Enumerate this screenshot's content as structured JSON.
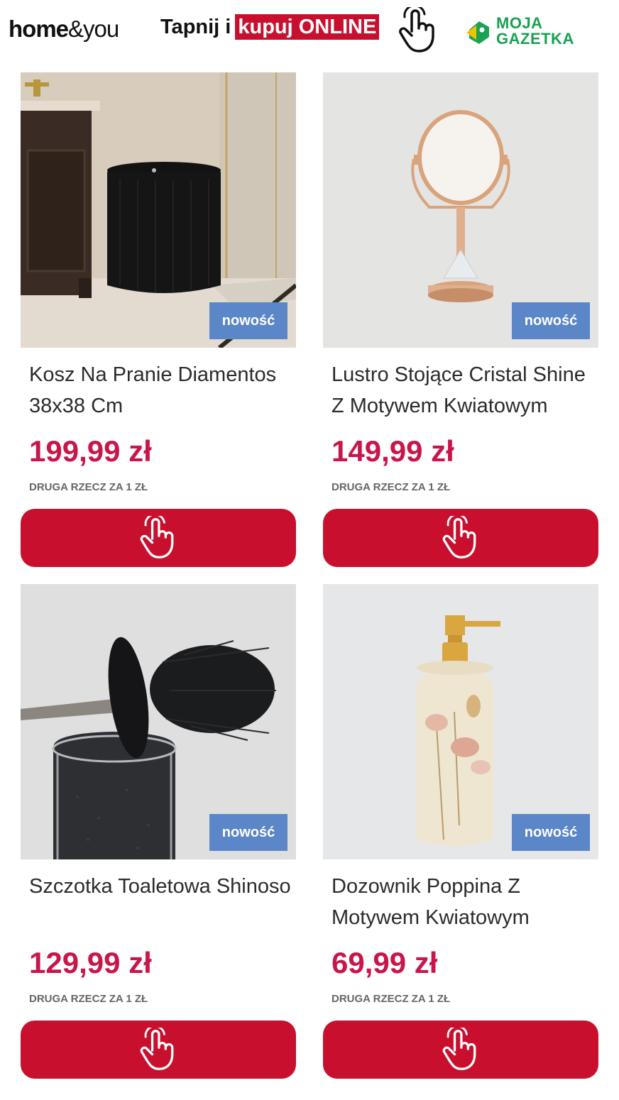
{
  "header": {
    "logo_home": "home",
    "logo_amp": "&you",
    "cta_prefix": "Tapnij i",
    "cta_highlight": "kupuj ONLINE",
    "gazetka_line1": "MOJA",
    "gazetka_line2": "GAZETKA"
  },
  "colors": {
    "brand_red": "#c8102e",
    "price_red": "#c8164a",
    "badge_blue": "#5b86c7",
    "gazetka_green": "#1aa152"
  },
  "products": [
    {
      "badge": "nowość",
      "title": "Kosz Na Pranie Diamentos 38x38 Cm",
      "price": "199,99 zł",
      "promo": "DRUGA RZECZ ZA 1 ZŁ",
      "button_icon": "hand-pointer-icon"
    },
    {
      "badge": "nowość",
      "title": "Lustro Stojące Cristal Shine Z Motywem Kwiatowym",
      "price": "149,99 zł",
      "promo": "DRUGA RZECZ ZA 1 ZŁ",
      "button_icon": "hand-pointer-icon"
    },
    {
      "badge": "nowość",
      "title": "Szczotka Toaletowa Shinoso",
      "price": "129,99 zł",
      "promo": "DRUGA RZECZ ZA 1 ZŁ",
      "button_icon": "hand-pointer-icon"
    },
    {
      "badge": "nowość",
      "title": "Dozownik Poppina Z Motywem Kwiatowym",
      "price": "69,99 zł",
      "promo": "DRUGA RZECZ ZA 1 ZŁ",
      "button_icon": "hand-pointer-icon"
    }
  ]
}
